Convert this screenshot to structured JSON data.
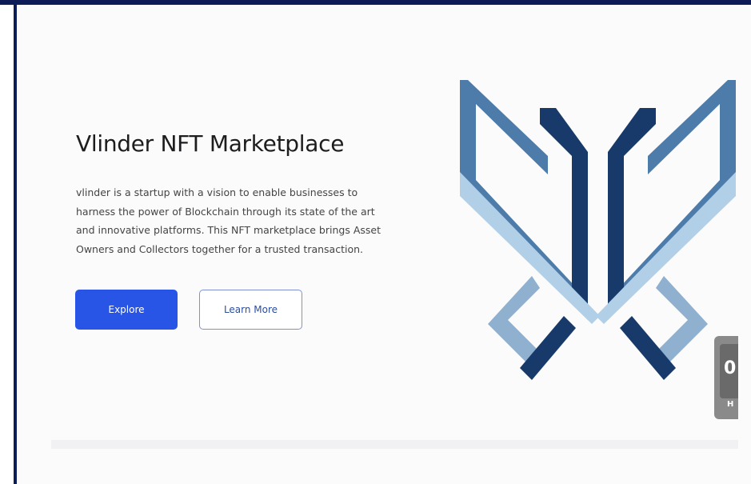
{
  "hero": {
    "title": "Vlinder NFT Marketplace",
    "description": "vlinder is a startup with a vision to enable businesses to harness the power of Blockchain through its state of the art and innovative platforms. This NFT marketplace brings Asset Owners and Collectors together for a trusted transaction.",
    "explore_label": "Explore",
    "learn_more_label": "Learn More"
  },
  "side_widget": {
    "glyph": "0",
    "label": "H"
  },
  "colors": {
    "primary_button": "#2855e6",
    "outline_button_text": "#2b4ea2",
    "logo_dark": "#173a6b",
    "logo_mid": "#4d7cab",
    "logo_light": "#b2cfe8",
    "frame_border": "#0d1b56"
  }
}
